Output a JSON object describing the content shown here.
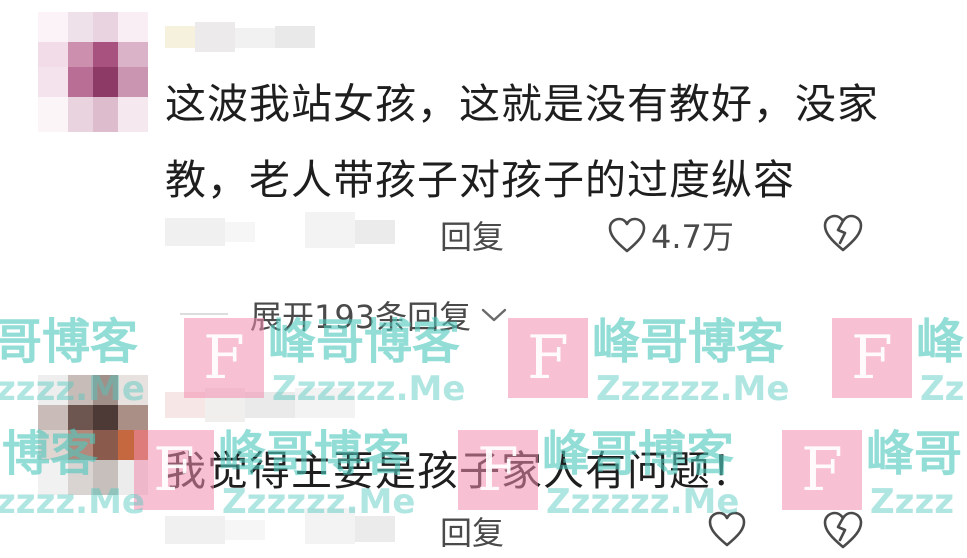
{
  "colors": {
    "text": "#1e1e1e",
    "secondary_text": "#4a4a4a",
    "watermark_teal": "#50c8be",
    "watermark_pink": "#f28caf"
  },
  "comments": [
    {
      "text": "这波我站女孩，这就是没有教好，没家教，老人带孩子对孩子的过度纵容",
      "reply_label": "回复",
      "like_count": "4.7万",
      "like_icon": "heart-outline-icon",
      "dislike_icon": "broken-heart-icon"
    },
    {
      "text": "我觉得主要是孩子家人有问题！",
      "reply_label": "回复",
      "like_count": "",
      "like_icon": "heart-outline-icon",
      "dislike_icon": "broken-heart-icon"
    }
  ],
  "expand_replies": {
    "label": "展开193条回复",
    "icon": "chevron-down-icon"
  },
  "watermark": {
    "name": "峰哥博客",
    "partial_name_right": "峰",
    "partial_name_left": "哥博客",
    "partial_name_left_row2": "博客",
    "partial_name_right_row2": "峰哥",
    "domain": "Zzzzzz.Me",
    "partial_domain_left": "zzzz.Me",
    "partial_domain_right": "Zz",
    "partial_domain_right_row2": "Zzzz",
    "logo_letter": "F"
  }
}
